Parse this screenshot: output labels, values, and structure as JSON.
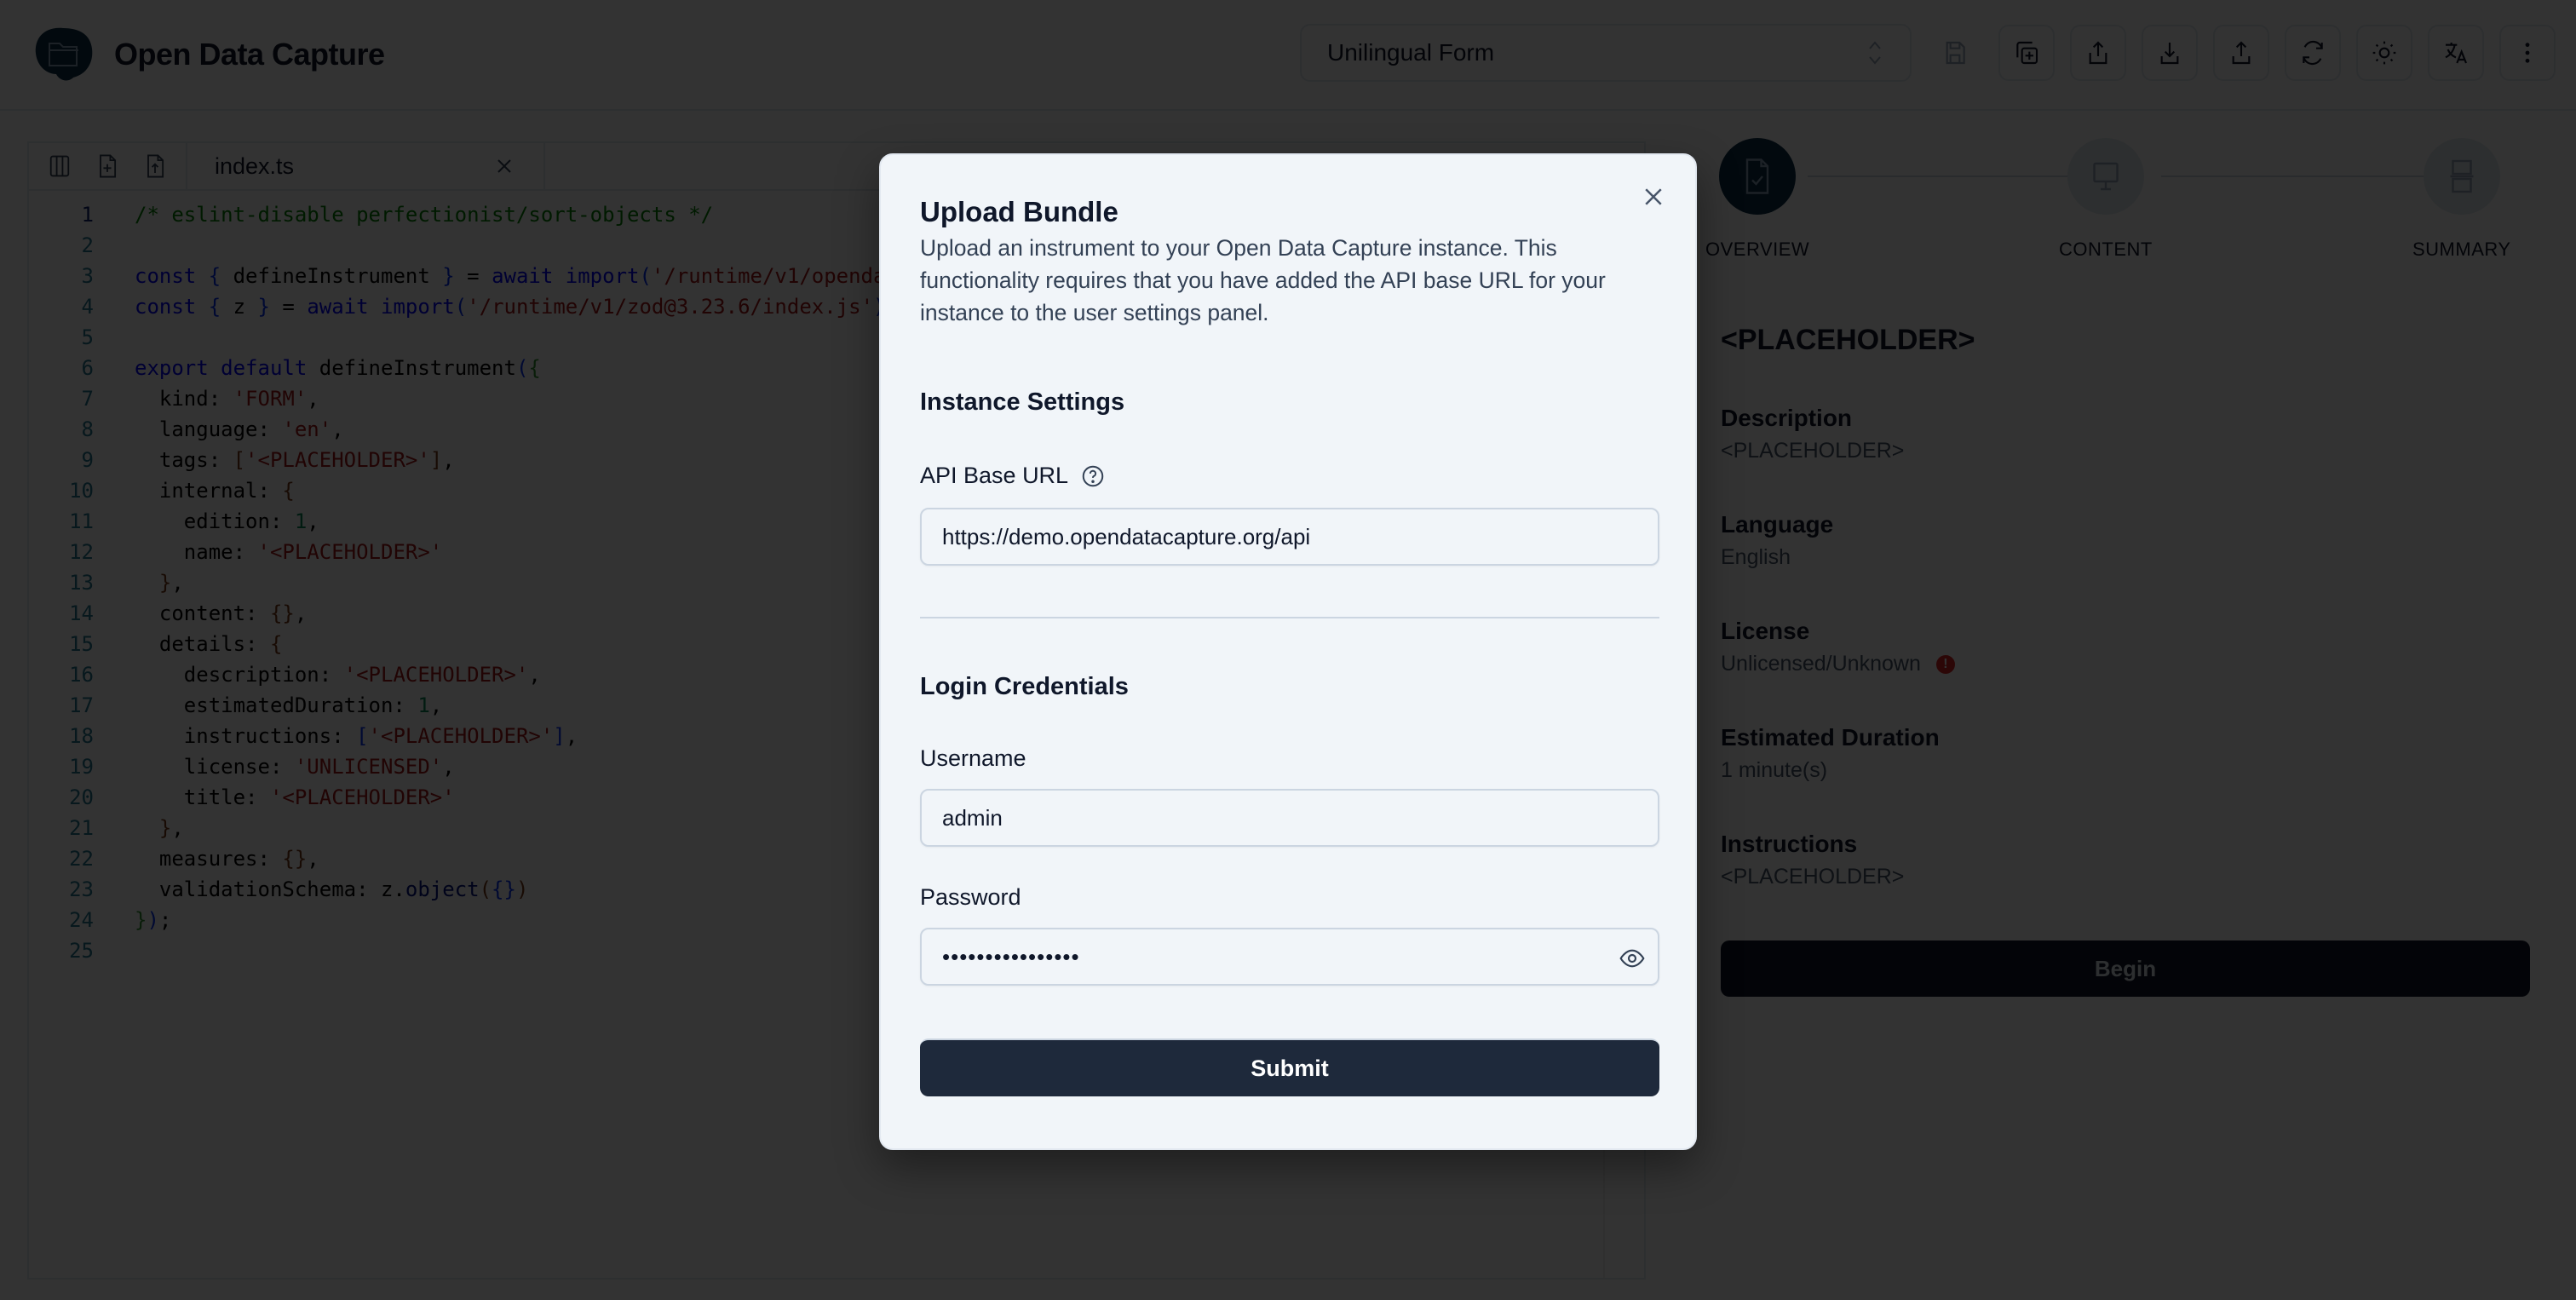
{
  "app": {
    "title": "Open Data Capture"
  },
  "toolbar": {
    "form_type": "Unilingual Form",
    "buttons": [
      {
        "name": "save-icon",
        "label": "Save",
        "disabled": true
      },
      {
        "name": "copy-add-icon",
        "label": "Copy",
        "disabled": false
      },
      {
        "name": "share-icon",
        "label": "Share",
        "disabled": false
      },
      {
        "name": "download-icon",
        "label": "Download",
        "disabled": false
      },
      {
        "name": "upload-icon",
        "label": "Upload",
        "disabled": false
      },
      {
        "name": "refresh-icon",
        "label": "Refresh",
        "disabled": false
      },
      {
        "name": "sun-icon",
        "label": "Theme",
        "disabled": false
      },
      {
        "name": "translate-icon",
        "label": "Language",
        "disabled": false
      },
      {
        "name": "more-vertical-icon",
        "label": "More",
        "disabled": false
      }
    ]
  },
  "editor": {
    "actions": [
      "columns-icon",
      "file-plus-icon",
      "file-upload-icon"
    ],
    "active_file": "index.ts",
    "lines": [
      {
        "n": "1",
        "tokens": [
          [
            "tk-comment",
            "/* eslint-disable perfectionist/sort-objects */"
          ]
        ]
      },
      {
        "n": "2",
        "tokens": []
      },
      {
        "n": "3",
        "tokens": [
          [
            "tk-kw",
            "const"
          ],
          [
            "",
            " "
          ],
          [
            "tk-br1",
            "{"
          ],
          [
            "",
            " defineInstrument "
          ],
          [
            "tk-br1",
            "}"
          ],
          [
            "",
            " = "
          ],
          [
            "tk-kw",
            "await"
          ],
          [
            "",
            " "
          ],
          [
            "tk-kw",
            "import"
          ],
          [
            "tk-br1",
            "("
          ],
          [
            "tk-str",
            "'/runtime/v1/openda"
          ]
        ]
      },
      {
        "n": "4",
        "tokens": [
          [
            "tk-kw",
            "const"
          ],
          [
            "",
            " "
          ],
          [
            "tk-br1",
            "{"
          ],
          [
            "",
            " z "
          ],
          [
            "tk-br1",
            "}"
          ],
          [
            "",
            " = "
          ],
          [
            "tk-kw",
            "await"
          ],
          [
            "",
            " "
          ],
          [
            "tk-kw",
            "import"
          ],
          [
            "tk-br1",
            "("
          ],
          [
            "tk-str",
            "'/runtime/v1/zod@3.23.6/index.js'"
          ],
          [
            "tk-br1",
            ")"
          ],
          [
            "",
            ";"
          ]
        ]
      },
      {
        "n": "5",
        "tokens": []
      },
      {
        "n": "6",
        "tokens": [
          [
            "tk-kw",
            "export"
          ],
          [
            "",
            " "
          ],
          [
            "tk-kw",
            "default"
          ],
          [
            "",
            " defineInstrument"
          ],
          [
            "tk-br1",
            "("
          ],
          [
            "tk-br2",
            "{"
          ]
        ]
      },
      {
        "n": "7",
        "tokens": [
          [
            "",
            "  kind: "
          ],
          [
            "tk-str",
            "'FORM'"
          ],
          [
            "",
            ","
          ]
        ]
      },
      {
        "n": "8",
        "tokens": [
          [
            "",
            "  language: "
          ],
          [
            "tk-str",
            "'en'"
          ],
          [
            "",
            ","
          ]
        ]
      },
      {
        "n": "9",
        "tokens": [
          [
            "",
            "  tags: "
          ],
          [
            "tk-br3",
            "["
          ],
          [
            "tk-str",
            "'<PLACEHOLDER>'"
          ],
          [
            "tk-br3",
            "]"
          ],
          [
            "",
            ","
          ]
        ]
      },
      {
        "n": "10",
        "tokens": [
          [
            "",
            "  internal: "
          ],
          [
            "tk-br3",
            "{"
          ]
        ]
      },
      {
        "n": "11",
        "tokens": [
          [
            "",
            "    edition: "
          ],
          [
            "tk-num",
            "1"
          ],
          [
            "",
            ","
          ]
        ]
      },
      {
        "n": "12",
        "tokens": [
          [
            "",
            "    name: "
          ],
          [
            "tk-str",
            "'<PLACEHOLDER>'"
          ]
        ]
      },
      {
        "n": "13",
        "tokens": [
          [
            "",
            "  "
          ],
          [
            "tk-br3",
            "}"
          ],
          [
            "",
            ","
          ]
        ]
      },
      {
        "n": "14",
        "tokens": [
          [
            "",
            "  content: "
          ],
          [
            "tk-br3",
            "{}"
          ],
          [
            "",
            ","
          ]
        ]
      },
      {
        "n": "15",
        "tokens": [
          [
            "",
            "  details: "
          ],
          [
            "tk-br3",
            "{"
          ]
        ]
      },
      {
        "n": "16",
        "tokens": [
          [
            "",
            "    description: "
          ],
          [
            "tk-str",
            "'<PLACEHOLDER>'"
          ],
          [
            "",
            ","
          ]
        ]
      },
      {
        "n": "17",
        "tokens": [
          [
            "",
            "    estimatedDuration: "
          ],
          [
            "tk-num",
            "1"
          ],
          [
            "",
            ","
          ]
        ]
      },
      {
        "n": "18",
        "tokens": [
          [
            "",
            "    instructions: "
          ],
          [
            "tk-br1",
            "["
          ],
          [
            "tk-str",
            "'<PLACEHOLDER>'"
          ],
          [
            "tk-br1",
            "]"
          ],
          [
            "",
            ","
          ]
        ]
      },
      {
        "n": "19",
        "tokens": [
          [
            "",
            "    license: "
          ],
          [
            "tk-str",
            "'UNLICENSED'"
          ],
          [
            "",
            ","
          ]
        ]
      },
      {
        "n": "20",
        "tokens": [
          [
            "",
            "    title: "
          ],
          [
            "tk-str",
            "'<PLACEHOLDER>'"
          ]
        ]
      },
      {
        "n": "21",
        "tokens": [
          [
            "",
            "  "
          ],
          [
            "tk-br3",
            "}"
          ],
          [
            "",
            ","
          ]
        ]
      },
      {
        "n": "22",
        "tokens": [
          [
            "",
            "  measures: "
          ],
          [
            "tk-br3",
            "{}"
          ],
          [
            "",
            ","
          ]
        ]
      },
      {
        "n": "23",
        "tokens": [
          [
            "",
            "  validationSchema: z."
          ],
          [
            "tk-fn",
            "object"
          ],
          [
            "tk-br3",
            "("
          ],
          [
            "tk-br1",
            "{}"
          ],
          [
            "tk-br3",
            ")"
          ]
        ]
      },
      {
        "n": "24",
        "tokens": [
          [
            "tk-br2",
            "}"
          ],
          [
            "tk-br1",
            ")"
          ],
          [
            "",
            ";"
          ]
        ]
      },
      {
        "n": "25",
        "tokens": []
      }
    ]
  },
  "preview": {
    "steps": [
      {
        "label": "OVERVIEW",
        "icon": "file-check-icon",
        "active": true
      },
      {
        "label": "CONTENT",
        "icon": "monitor-icon",
        "active": false
      },
      {
        "label": "SUMMARY",
        "icon": "summary-icon",
        "active": false
      }
    ],
    "title": "<PLACEHOLDER>",
    "fields": [
      {
        "label": "Description",
        "value": "<PLACEHOLDER>",
        "warning": false
      },
      {
        "label": "Language",
        "value": "English",
        "warning": false
      },
      {
        "label": "License",
        "value": "Unlicensed/Unknown",
        "warning": true
      },
      {
        "label": "Estimated Duration",
        "value": "1 minute(s)",
        "warning": false
      },
      {
        "label": "Instructions",
        "value": "<PLACEHOLDER>",
        "warning": false
      }
    ],
    "begin_label": "Begin"
  },
  "modal": {
    "title": "Upload Bundle",
    "description": "Upload an instrument to your Open Data Capture instance. This functionality requires that you have added the API base URL for your instance to the user settings panel.",
    "instance_section": "Instance Settings",
    "api_label": "API Base URL",
    "api_value": "https://demo.opendatacapture.org/api",
    "credentials_section": "Login Credentials",
    "username_label": "Username",
    "username_value": "admin",
    "password_label": "Password",
    "password_mask": "••••••••••••••••",
    "submit_label": "Submit"
  },
  "colors": {
    "primary": "#1e293b",
    "modal_bg": "#f1f5f9",
    "brand": "#0c2d48",
    "warning": "#dc2626"
  }
}
